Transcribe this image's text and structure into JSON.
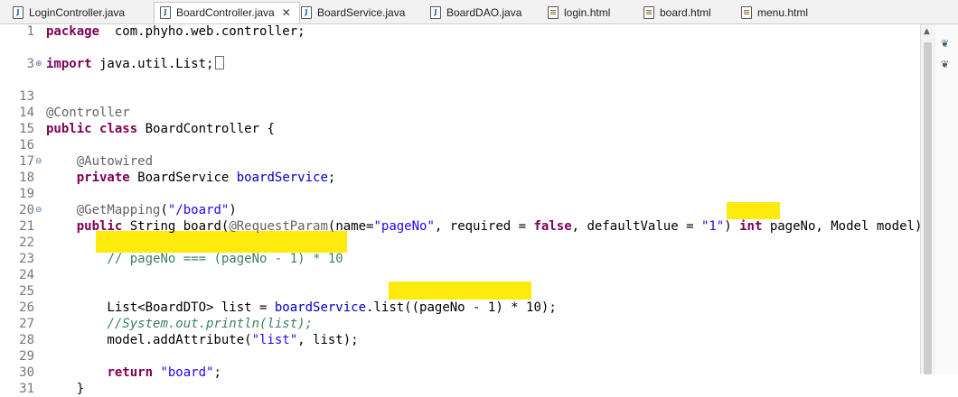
{
  "tabs": [
    {
      "label": "LoginController.java",
      "icon": "java-file-icon"
    },
    {
      "label": "BoardController.java",
      "icon": "java-file-icon",
      "active": true,
      "close": "✕"
    },
    {
      "label": "BoardService.java",
      "icon": "java-file-icon"
    },
    {
      "label": "BoardDAO.java",
      "icon": "java-file-icon"
    },
    {
      "label": "login.html",
      "icon": "html-file-icon"
    },
    {
      "label": "board.html",
      "icon": "html-file-icon"
    },
    {
      "label": "menu.html",
      "icon": "html-file-icon"
    }
  ],
  "editor": {
    "lines": [
      {
        "num": "1",
        "parts": [
          [
            "kw",
            "package"
          ],
          [
            "",
            "  com.phyho.web.controller;"
          ]
        ]
      },
      {
        "num": "3",
        "fold": "⊕",
        "parts": [
          [
            "kw",
            "import"
          ],
          [
            "",
            " java.util.List;"
          ]
        ],
        "box": true
      },
      {
        "num": "13",
        "parts": []
      },
      {
        "num": "14",
        "parts": [
          [
            "ann",
            "@Controller"
          ]
        ]
      },
      {
        "num": "15",
        "parts": [
          [
            "kw",
            "public"
          ],
          [
            "",
            " "
          ],
          [
            "kw",
            "class"
          ],
          [
            "",
            " BoardController {"
          ]
        ]
      },
      {
        "num": "16",
        "parts": []
      },
      {
        "num": "17",
        "fold": "⊖",
        "parts": [
          [
            "",
            "    "
          ],
          [
            "ann",
            "@Autowired"
          ]
        ]
      },
      {
        "num": "18",
        "parts": [
          [
            "",
            "    "
          ],
          [
            "kw",
            "private"
          ],
          [
            "",
            " BoardService "
          ],
          [
            "fld",
            "boardService"
          ],
          [
            "",
            ";"
          ]
        ]
      },
      {
        "num": "19",
        "parts": []
      },
      {
        "num": "20",
        "fold": "⊖",
        "parts": [
          [
            "",
            "    "
          ],
          [
            "ann",
            "@GetMapping"
          ],
          [
            "",
            "("
          ],
          [
            "str",
            "\"/board\""
          ],
          [
            "",
            ")"
          ]
        ]
      },
      {
        "num": "21",
        "parts": [
          [
            "",
            "    "
          ],
          [
            "kw",
            "public"
          ],
          [
            "",
            " String board("
          ],
          [
            "ann",
            "@RequestParam"
          ],
          [
            "",
            "(name="
          ],
          [
            "str",
            "\"pageNo\""
          ],
          [
            "",
            ", required = "
          ],
          [
            "kw",
            "false"
          ],
          [
            "",
            ", defaultValue = "
          ],
          [
            "str",
            "\"1\""
          ],
          [
            "",
            ") "
          ],
          [
            "kw",
            "int"
          ],
          [
            "",
            " pageNo, Model model) {"
          ]
        ]
      },
      {
        "num": "22",
        "parts": []
      },
      {
        "num": "23",
        "parts": [
          [
            "",
            "        "
          ],
          [
            "cmt",
            "// pageNo === (pageNo - 1) * 10"
          ]
        ]
      },
      {
        "num": "24",
        "parts": []
      },
      {
        "num": "25",
        "parts": []
      },
      {
        "num": "26",
        "parts": [
          [
            "",
            "        List<BoardDTO> list = "
          ],
          [
            "fld",
            "boardService"
          ],
          [
            "",
            ".list((pageNo - 1) * 10);"
          ]
        ]
      },
      {
        "num": "27",
        "parts": [
          [
            "",
            "        "
          ],
          [
            "cmtit",
            "//System.out.println(list);"
          ]
        ]
      },
      {
        "num": "28",
        "parts": [
          [
            "",
            "        model.addAttribute("
          ],
          [
            "str",
            "\"list\""
          ],
          [
            "",
            ", list);"
          ]
        ]
      },
      {
        "num": "29",
        "parts": []
      },
      {
        "num": "30",
        "parts": [
          [
            "",
            "        "
          ],
          [
            "kw",
            "return"
          ],
          [
            "",
            " "
          ],
          [
            "str",
            "\"board\""
          ],
          [
            "",
            ";"
          ]
        ]
      },
      {
        "num": "31",
        "parts": [
          [
            "",
            "    }"
          ]
        ]
      }
    ]
  },
  "colors": {
    "keyword": "#7f0055",
    "string": "#2a00ff",
    "field": "#0000c0",
    "comment": "#3f7f5f",
    "highlight": "#ffe900"
  }
}
